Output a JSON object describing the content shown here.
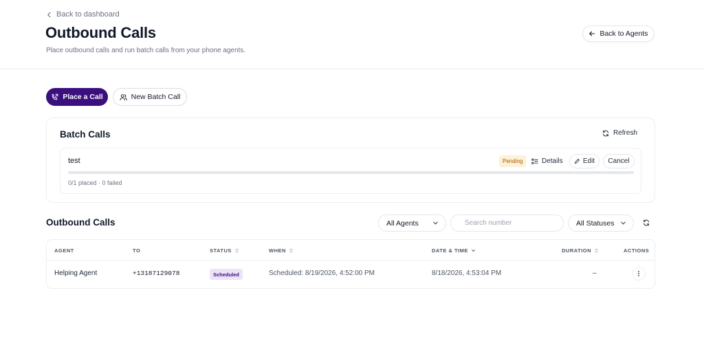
{
  "header": {
    "back_link": "Back to dashboard",
    "title": "Outbound Calls",
    "subtitle": "Place outbound calls and run batch calls from your phone agents.",
    "back_agents": "Back to Agents"
  },
  "actions": {
    "place_call": "Place a Call",
    "new_batch": "New Batch Call"
  },
  "batch_section": {
    "title": "Batch Calls",
    "refresh": "Refresh",
    "items": [
      {
        "name": "test",
        "status": "Pending",
        "details": "Details",
        "edit": "Edit",
        "cancel": "Cancel",
        "progress_fraction": 0,
        "meta": "0/1 placed · 0 failed"
      }
    ]
  },
  "calls_section": {
    "title": "Outbound Calls",
    "agent_filter": "All Agents",
    "search_placeholder": "Search number",
    "status_filter": "All Statuses",
    "columns": {
      "agent": "Agent",
      "to": "To",
      "status": "Status",
      "when": "When",
      "datetime": "Date & Time",
      "duration": "Duration",
      "actions": "Actions"
    },
    "rows": [
      {
        "agent": "Helping Agent",
        "to": "+13187129078",
        "status": "Scheduled",
        "when": "Scheduled: 8/19/2026, 4:52:00 PM",
        "datetime": "8/18/2026, 4:53:04 PM",
        "duration": "–"
      }
    ]
  },
  "colors": {
    "accent": "#3b0f7e",
    "pending_bg": "#fdf1d6",
    "pending_text": "#b45309",
    "scheduled_bg": "#ede3f7"
  },
  "icons": {
    "back": "chevron-left-icon",
    "back_agents": "arrow-left-icon",
    "place_call": "phone-outgoing-icon",
    "new_batch": "users-icon",
    "refresh": "refresh-icon",
    "details": "list-icon",
    "edit": "pencil-icon",
    "dropdown": "chevron-down-icon",
    "sort": "sort-icon",
    "row_actions": "more-vertical-icon"
  }
}
